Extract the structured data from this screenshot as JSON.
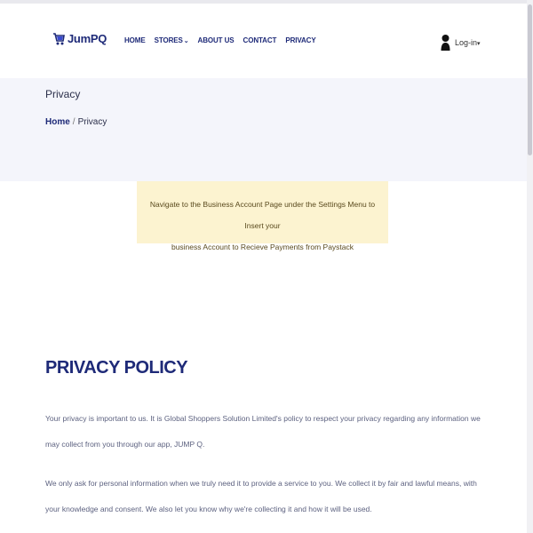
{
  "navbar": {
    "logo_text": "JumPQ",
    "links": [
      {
        "label": "HOME"
      },
      {
        "label": "STORES",
        "has_dropdown": true
      },
      {
        "label": "ABOUT US"
      },
      {
        "label": "CONTACT"
      },
      {
        "label": "PRIVACY"
      }
    ],
    "login_label": "Log-in"
  },
  "banner": {
    "title": "Privacy",
    "breadcrumb": {
      "home": "Home",
      "separator": "/",
      "current": "Privacy"
    }
  },
  "alert": {
    "line1": "Navigate to the Business Account Page under the Settings Menu to Insert your",
    "line2": "business Account to Recieve Payments from Paystack"
  },
  "content": {
    "heading": "PRIVACY POLICY",
    "paragraphs": [
      "Your privacy is important to us. It is Global Shoppers Solution Limited's policy to respect your privacy regarding any information we may collect from you through our app, JUMP Q.",
      "We only ask for personal information when we truly need it to provide a service to you. We collect it by fair and lawful means, with your knowledge and consent. We also let you know why we're collecting it and how it will be used."
    ]
  },
  "colors": {
    "brand": "#1e2a78",
    "banner_bg": "#f4f5fb",
    "alert_bg": "#fcf3d0",
    "body_text": "#5d6280"
  }
}
